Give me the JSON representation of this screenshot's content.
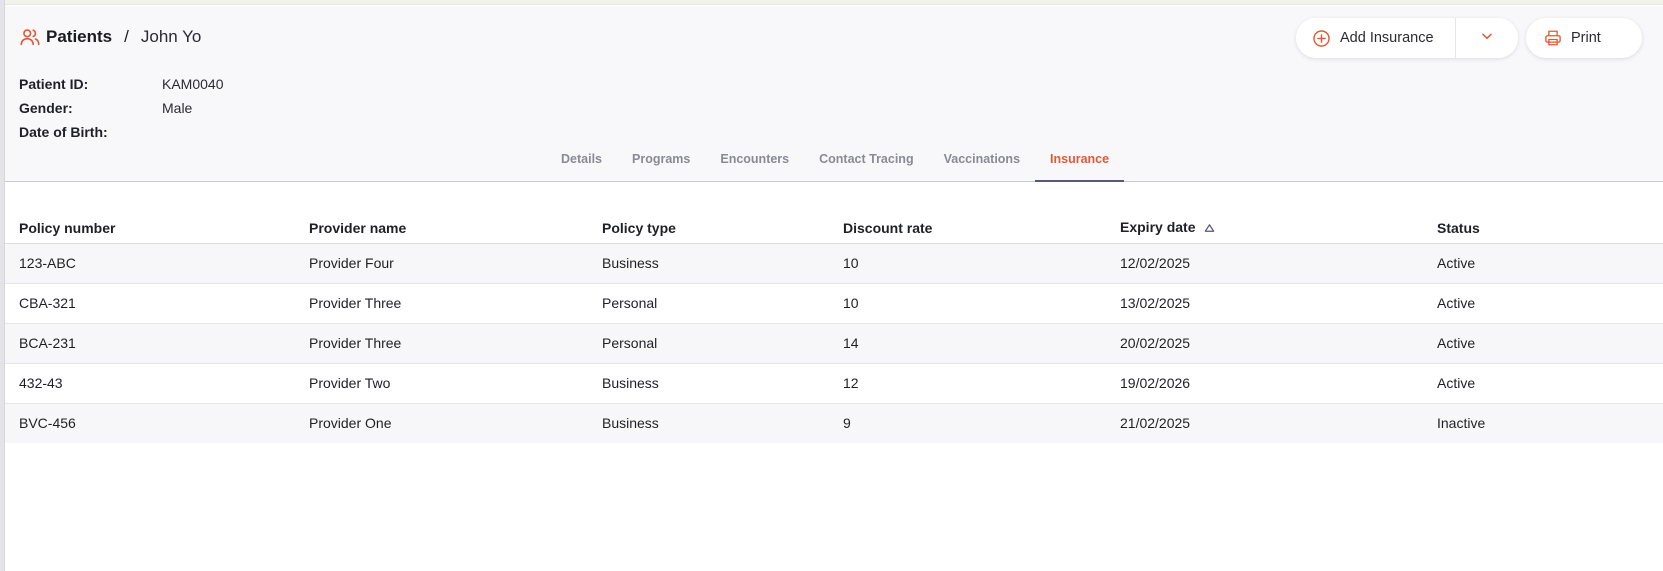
{
  "breadcrumb": {
    "root": "Patients",
    "separator": "/",
    "current": "John Yo",
    "icon": "users-icon"
  },
  "patient": {
    "id_label": "Patient ID:",
    "id_value": "KAM0040",
    "gender_label": "Gender:",
    "gender_value": "Male",
    "dob_label": "Date of Birth:",
    "dob_value": ""
  },
  "actions": {
    "add_insurance_label": "Add Insurance",
    "add_icon": "plus-circle-icon",
    "caret_icon": "chevron-down-icon",
    "print_label": "Print",
    "print_icon": "printer-icon"
  },
  "tabs": [
    {
      "label": "Details",
      "active": false
    },
    {
      "label": "Programs",
      "active": false
    },
    {
      "label": "Encounters",
      "active": false
    },
    {
      "label": "Contact Tracing",
      "active": false
    },
    {
      "label": "Vaccinations",
      "active": false
    },
    {
      "label": "Insurance",
      "active": true
    }
  ],
  "table": {
    "columns": [
      "Policy number",
      "Provider name",
      "Policy type",
      "Discount rate",
      "Expiry date",
      "Status"
    ],
    "sorted_column": "Expiry date",
    "sort_icon": "sort-ascending-icon",
    "rows": [
      [
        "123-ABC",
        "Provider Four",
        "Business",
        "10",
        "12/02/2025",
        "Active"
      ],
      [
        "CBA-321",
        "Provider Three",
        "Personal",
        "10",
        "13/02/2025",
        "Active"
      ],
      [
        "BCA-231",
        "Provider Three",
        "Personal",
        "14",
        "20/02/2025",
        "Active"
      ],
      [
        "432-43",
        "Provider Two",
        "Business",
        "12",
        "19/02/2026",
        "Active"
      ],
      [
        "BVC-456",
        "Provider One",
        "Business",
        "9",
        "21/02/2025",
        "Inactive"
      ]
    ]
  },
  "colors": {
    "accent": "#e05a36",
    "tab_underline": "#565680",
    "header_bg": "#f8f8fa"
  }
}
